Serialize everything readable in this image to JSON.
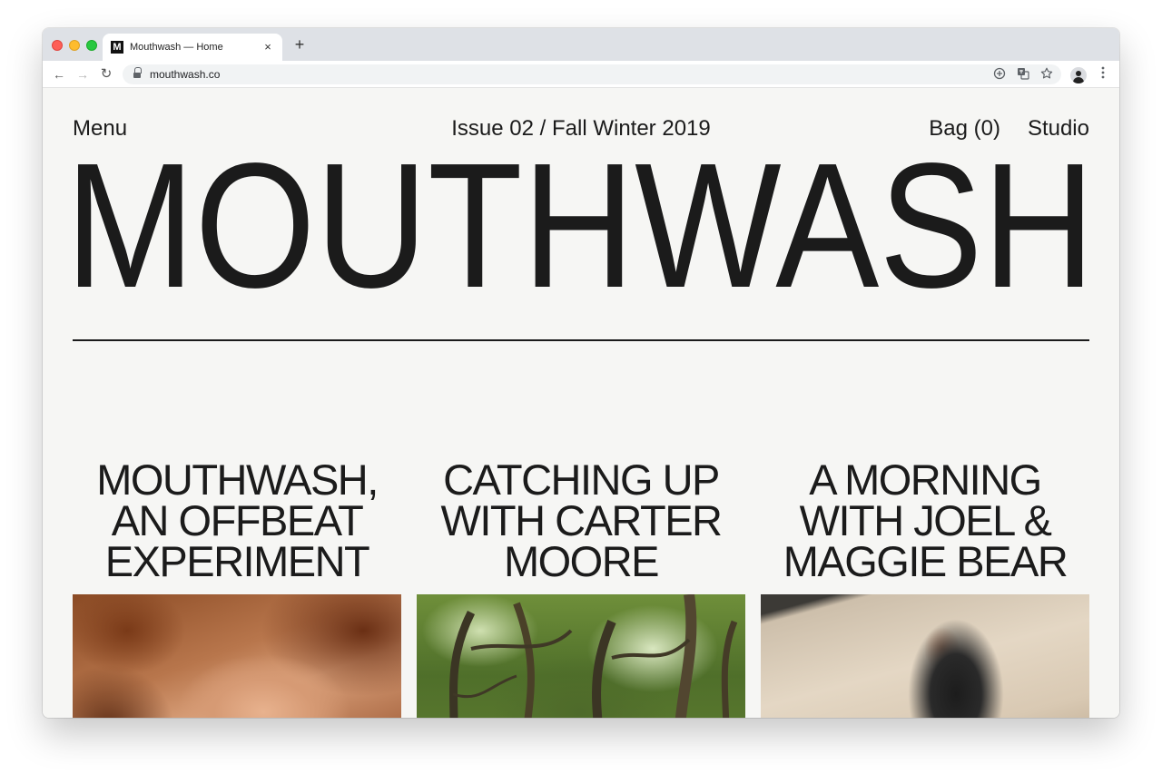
{
  "browser": {
    "tab": {
      "favicon": "M",
      "title": "Mouthwash — Home",
      "close": "×"
    },
    "new_tab": "+",
    "toolbar": {
      "back": "←",
      "forward": "→",
      "reload": "↻",
      "url": "mouthwash.co",
      "icons": [
        "add-icon",
        "translate-icon",
        "star-icon",
        "profile-icon",
        "menu-kebab-icon"
      ]
    }
  },
  "site": {
    "nav": {
      "menu": "Menu",
      "issue": "Issue 02 / Fall Winter 2019",
      "bag": "Bag (0)",
      "studio": "Studio"
    },
    "wordmark": "MOUTHWASH",
    "cards": [
      {
        "title_lines": [
          "MOUTHWASH,",
          "AN OFFBEAT",
          "EXPERIMENT"
        ],
        "image": "closeup portrait of a person with curly red hair"
      },
      {
        "title_lines": [
          "CATCHING UP",
          "WITH CARTER",
          "MOORE"
        ],
        "image": "forest of trees with green canopy"
      },
      {
        "title_lines": [
          "A MORNING",
          "WITH JOEL &",
          "MAGGIE BEAR"
        ],
        "image": "blurred figure in black walking past a wall"
      }
    ]
  }
}
